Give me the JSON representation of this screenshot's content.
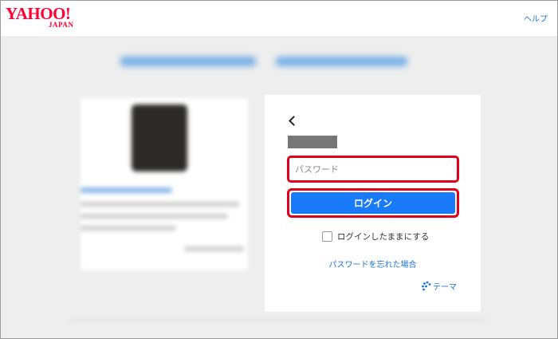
{
  "header": {
    "logo_main": "YAHOO!",
    "logo_sub": "JAPAN",
    "help_label": "ヘルプ"
  },
  "login": {
    "password_placeholder": "パスワード",
    "login_button_label": "ログイン",
    "keep_logged_in_label": "ログインしたままにする",
    "keep_logged_in_checked": false,
    "forgot_password_label": "パスワードを忘れた場合",
    "theme_label": "テーマ"
  },
  "colors": {
    "brand_red": "#ff0033",
    "highlight_red": "#e0001b",
    "primary_blue": "#1a7bfa",
    "link_blue": "#1a73d9"
  }
}
